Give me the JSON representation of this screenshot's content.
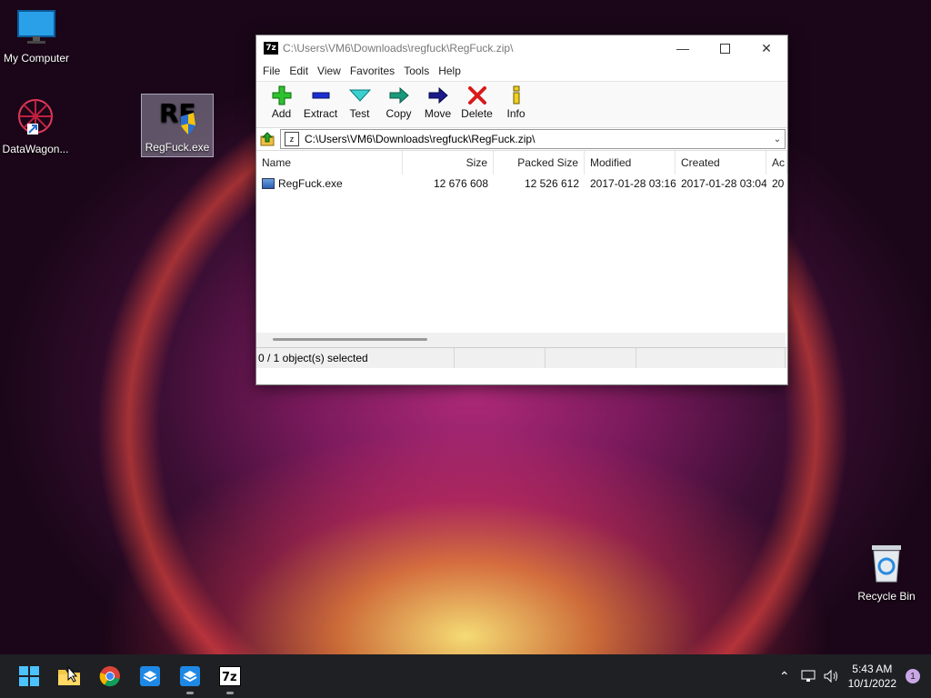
{
  "desktop": {
    "icons": [
      {
        "label": "My Computer"
      },
      {
        "label": "DataWagon..."
      },
      {
        "label": "RegFuck.exe"
      },
      {
        "label": "Recycle Bin"
      }
    ]
  },
  "window": {
    "app_icon": "7z",
    "title": "C:\\Users\\VM6\\Downloads\\regfuck\\RegFuck.zip\\",
    "menu": [
      "File",
      "Edit",
      "View",
      "Favorites",
      "Tools",
      "Help"
    ],
    "toolbar": [
      {
        "label": "Add",
        "icon": "add-icon"
      },
      {
        "label": "Extract",
        "icon": "extract-icon"
      },
      {
        "label": "Test",
        "icon": "test-icon"
      },
      {
        "label": "Copy",
        "icon": "copy-icon"
      },
      {
        "label": "Move",
        "icon": "move-icon"
      },
      {
        "label": "Delete",
        "icon": "delete-icon"
      },
      {
        "label": "Info",
        "icon": "info-icon"
      }
    ],
    "address": "C:\\Users\\VM6\\Downloads\\regfuck\\RegFuck.zip\\",
    "columns": [
      "Name",
      "Size",
      "Packed Size",
      "Modified",
      "Created",
      "Ac"
    ],
    "rows": [
      {
        "name": "RegFuck.exe",
        "size": "12 676 608",
        "packed": "12 526 612",
        "modified": "2017-01-28 03:16",
        "created": "2017-01-28 03:04",
        "accessed": "20"
      }
    ],
    "status": "0 / 1 object(s) selected"
  },
  "taskbar": {
    "clock_time": "5:43 AM",
    "clock_date": "10/1/2022",
    "notification_count": "1"
  }
}
